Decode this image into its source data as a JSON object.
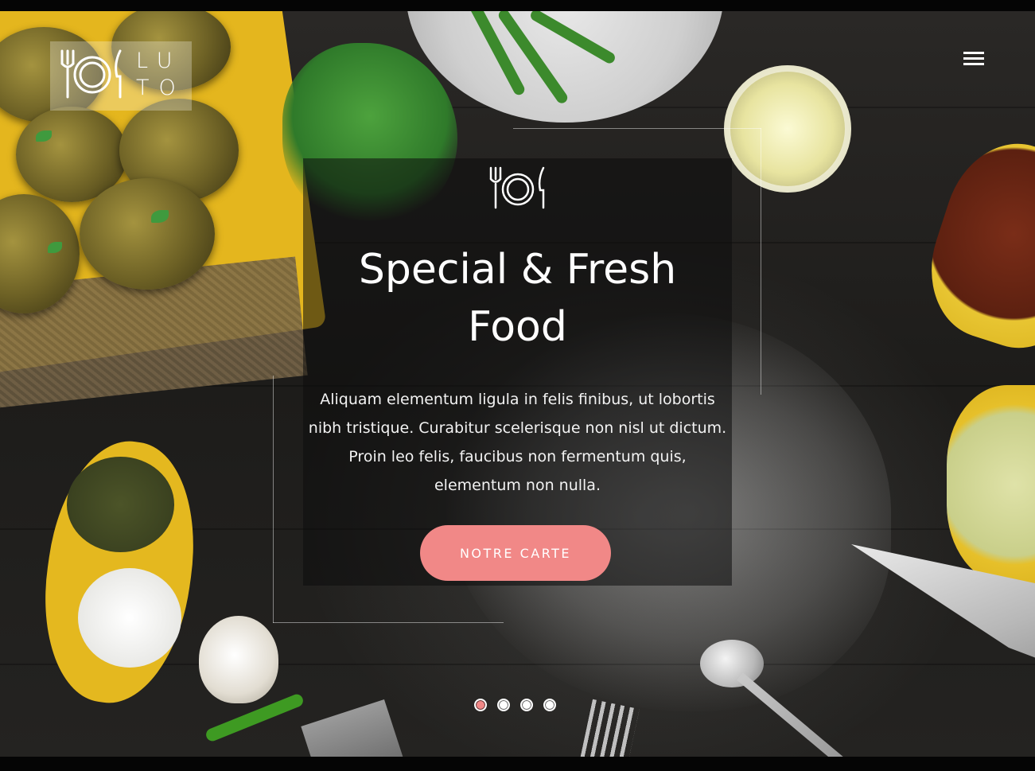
{
  "header": {
    "logo_text": "LUTO",
    "logo_icon": "plate-cutlery-icon",
    "menu_icon": "hamburger-menu-icon"
  },
  "slide": {
    "icon": "plate-cutlery-icon",
    "title": "Special & Fresh Food",
    "description": "Aliquam elementum ligula in felis finibus, ut lobortis nibh tristique. Curabitur scelerisque non nisl ut dictum. Proin leo felis, faucibus non fermentum quis, elementum non nulla.",
    "button_label": "NOTRE CARTE"
  },
  "slider": {
    "active_index": 0,
    "slide_count": 4
  },
  "colors": {
    "accent": "#f18887",
    "text": "#ffffff",
    "caption_bg": "rgba(12,12,12,0.55)"
  }
}
